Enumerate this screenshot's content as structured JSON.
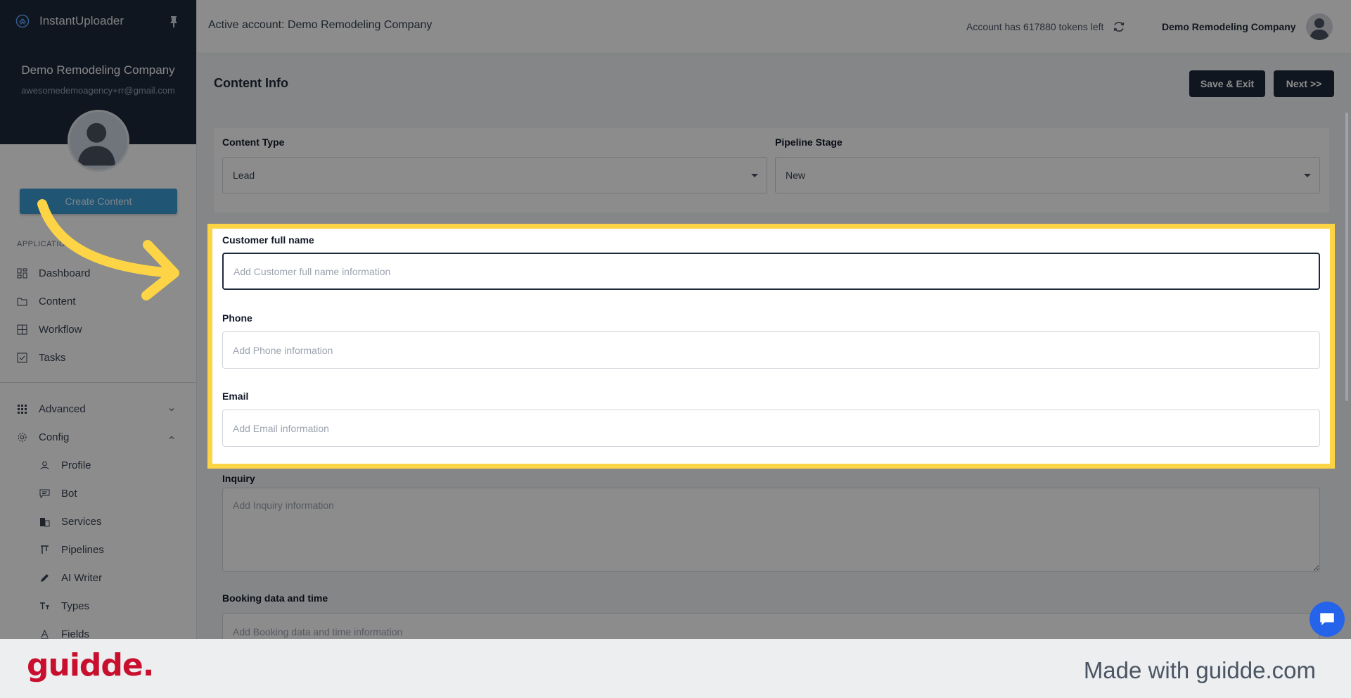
{
  "app": {
    "name": "InstantUploader"
  },
  "sidebar": {
    "company": "Demo Remodeling Company",
    "email": "awesomedemoagency+rr@gmail.com",
    "create_button": "Create Content",
    "section_label": "APPLICATIONS",
    "items": [
      {
        "label": "Dashboard",
        "icon": "dashboard-icon"
      },
      {
        "label": "Content",
        "icon": "folder-icon"
      },
      {
        "label": "Workflow",
        "icon": "grid-icon"
      },
      {
        "label": "Tasks",
        "icon": "checkbox-icon"
      }
    ],
    "groups": [
      {
        "label": "Advanced",
        "icon": "apps-icon",
        "state": "collapsed"
      },
      {
        "label": "Config",
        "icon": "gear-icon",
        "state": "expanded"
      }
    ],
    "config_items": [
      {
        "label": "Profile",
        "icon": "user-icon"
      },
      {
        "label": "Bot",
        "icon": "chat-icon"
      },
      {
        "label": "Services",
        "icon": "building-icon"
      },
      {
        "label": "Pipelines",
        "icon": "pipeline-icon"
      },
      {
        "label": "AI Writer",
        "icon": "pencil-icon"
      },
      {
        "label": "Types",
        "icon": "text-type-icon"
      },
      {
        "label": "Fields",
        "icon": "field-icon"
      }
    ]
  },
  "header": {
    "active_account": "Active account: Demo Remodeling Company",
    "tokens": "Account has 617880 tokens left",
    "company": "Demo Remodeling Company"
  },
  "main": {
    "title": "Content Info",
    "save_exit": "Save & Exit",
    "next": "Next >>",
    "content_type_label": "Content Type",
    "content_type_value": "Lead",
    "pipeline_stage_label": "Pipeline Stage",
    "pipeline_stage_value": "New",
    "fields": {
      "customer_label": "Customer full name",
      "customer_placeholder": "Add Customer full name information",
      "phone_label": "Phone",
      "phone_placeholder": "Add Phone information",
      "email_label": "Email",
      "email_placeholder": "Add Email information",
      "inquiry_label": "Inquiry",
      "inquiry_placeholder": "Add Inquiry information",
      "booking_label": "Booking data and time",
      "booking_placeholder": "Add Booking data and time information"
    }
  },
  "footer": {
    "logo": "guidde.",
    "made_with": "Made with guidde.com"
  },
  "colors": {
    "highlight": "#fdd446",
    "dark": "#1e293b",
    "create_button": "#3b9bd4",
    "guidde_red": "#c8102e"
  }
}
